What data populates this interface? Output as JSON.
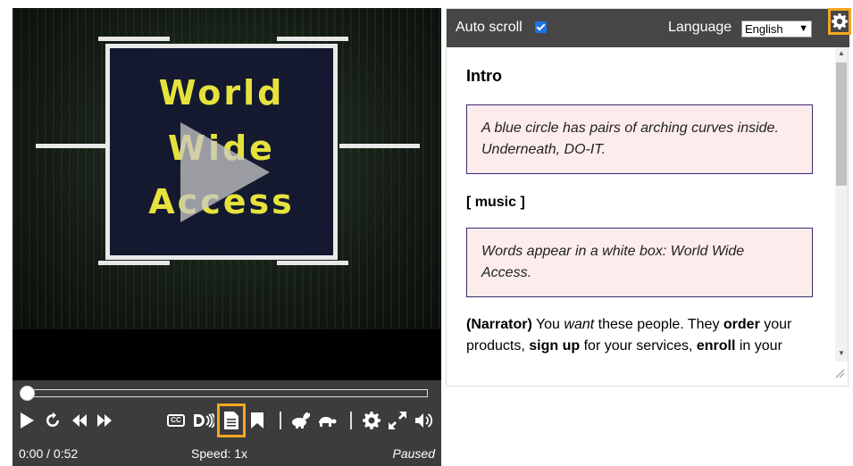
{
  "video": {
    "title_lines": [
      "World",
      "Wide",
      "Access"
    ]
  },
  "controls": {
    "elapsed": "0:00",
    "duration": "0:52",
    "time_display": "0:00 / 0:52",
    "speed": "Speed: 1x",
    "state": "Paused",
    "progress": 0.0,
    "cc_label": "CC",
    "buttons": [
      "play-icon",
      "restart-icon",
      "rewind-icon",
      "fast-forward-icon",
      "captions-icon",
      "audio-description-icon",
      "transcript-icon",
      "chapters-icon",
      "faster-icon",
      "slower-icon",
      "settings-icon",
      "fullscreen-icon",
      "volume-icon"
    ],
    "highlight_color": "#f5a623"
  },
  "transcript": {
    "autoscroll_label": "Auto scroll",
    "autoscroll_checked": true,
    "language_label": "Language",
    "language_value": "English",
    "heading": "Intro",
    "desc1": "A blue circle has pairs of arching curves inside. Underneath, DO-IT.",
    "music": "[ music ]",
    "desc2": "Words appear in a white box: World Wide Access.",
    "narration": {
      "speaker": "(Narrator)",
      "t1": " You ",
      "em1": "want",
      "t2": " these people. They ",
      "b1": "order",
      "t3": " your products, ",
      "b2": "sign up",
      "t4": " for your services, ",
      "b3": "enroll",
      "t5": " in your"
    },
    "desc_bg": "#fdecec",
    "desc_border": "#3a2a70",
    "toolbar_bg": "#464646"
  }
}
